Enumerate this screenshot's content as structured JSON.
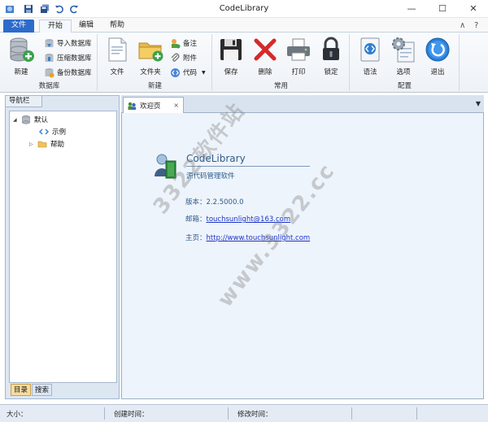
{
  "window": {
    "title": "CodeLibrary",
    "minimize_symbol": "—",
    "maximize_symbol": "☐",
    "close_symbol": "✕"
  },
  "quick_access": {
    "icons": [
      "app-icon",
      "save-icon",
      "save-all-icon",
      "undo-icon",
      "redo-icon"
    ]
  },
  "ribbon_tabs": {
    "file": "文件",
    "tabs": [
      "开始",
      "编辑",
      "帮助"
    ],
    "active": "开始",
    "collapse_symbol": "∧",
    "help_symbol": "?"
  },
  "ribbon": {
    "database": {
      "label": "数据库",
      "new": "新建",
      "import": "导入数据库",
      "compress": "压缩数据库",
      "backup": "备份数据库"
    },
    "create": {
      "label": "新建",
      "file": "文件",
      "folder": "文件夹",
      "note": "备注",
      "attachment": "附件",
      "code": "代码"
    },
    "common": {
      "label": "常用",
      "save": "保存",
      "delete": "删除",
      "print": "打印",
      "lock": "锁定"
    },
    "config": {
      "label": "配置",
      "syntax": "语法",
      "options": "选项",
      "exit": "退出"
    }
  },
  "nav": {
    "title": "导航栏",
    "tree": [
      {
        "label": "默认",
        "expanded": true
      },
      {
        "label": "示例"
      },
      {
        "label": "帮助",
        "expanded": false
      }
    ],
    "tab_directory": "目录",
    "tab_search": "搜索"
  },
  "doc": {
    "tab_label": "欢迎页",
    "close_symbol": "×",
    "dropdown_symbol": "▼"
  },
  "welcome": {
    "app_name": "CodeLibrary",
    "desc": "源代码管理软件",
    "version_label": "版本：",
    "version": "2.2.5000.0",
    "email_label": "邮箱：",
    "email": "touchsunlight@163.com",
    "home_label": "主页：",
    "home": "http://www.touchsunlight.com"
  },
  "watermark": {
    "line1": "3322软件站",
    "line2": "www.3322.cc"
  },
  "status": {
    "size": "大小：",
    "created": "创建时间：",
    "modified": "修改时间："
  },
  "colors": {
    "file_tab": "#2d6bcb",
    "link": "#1b34c8",
    "accent_text": "#2f5b8a",
    "selected_tab": "#f7dca0"
  }
}
